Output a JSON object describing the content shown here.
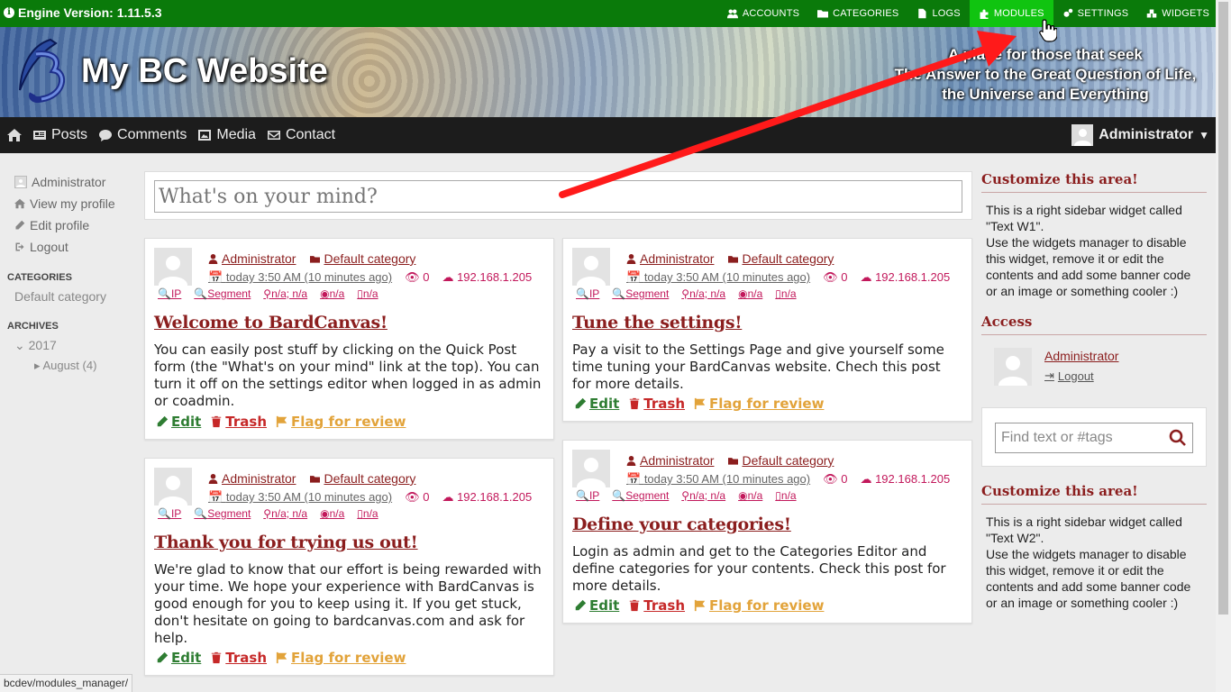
{
  "adminbar": {
    "version": "Engine Version: 1.11.5.3",
    "menu": [
      {
        "label": "Accounts",
        "icon": "users-icon"
      },
      {
        "label": "Categories",
        "icon": "folder-icon"
      },
      {
        "label": "Logs",
        "icon": "file-icon"
      },
      {
        "label": "Modules",
        "icon": "puzzle-icon",
        "active": true
      },
      {
        "label": "Settings",
        "icon": "cogs-icon"
      },
      {
        "label": "Widgets",
        "icon": "cubes-icon"
      }
    ],
    "active_color": "#10c410",
    "bar_color": "#0a7a0a"
  },
  "header": {
    "title": "My BC Website",
    "slogan_lines": [
      "A place for those that seek",
      "The Answer to the Great Question of Life,",
      "the Universe and Everything"
    ]
  },
  "mainnav": {
    "items": [
      {
        "label": "",
        "icon": "home-icon"
      },
      {
        "label": "Posts",
        "icon": "newspaper-icon"
      },
      {
        "label": "Comments",
        "icon": "comments-icon"
      },
      {
        "label": "Media",
        "icon": "image-icon"
      },
      {
        "label": "Contact",
        "icon": "envelope-icon"
      }
    ],
    "user": "Administrator"
  },
  "leftbar": {
    "user": "Administrator",
    "links": [
      "View my profile",
      "Edit profile",
      "Logout"
    ],
    "categories_heading": "Categories",
    "categories": [
      "Default category"
    ],
    "archives_heading": "Archives",
    "year": "2017",
    "month": "August (4)"
  },
  "quickpost": {
    "placeholder": "What's on your mind?"
  },
  "posts": [
    {
      "author": "Administrator",
      "category": "Default category",
      "date": "today 3:50 AM (10 minutes ago)",
      "views": "0",
      "ip": "192.168.1.205",
      "ip_label": "IP",
      "segment": "Segment",
      "location": "n/a; n/a",
      "isp": "n/a",
      "device": "n/a",
      "title": "Welcome to BardCanvas!",
      "text": "You can easily post stuff by clicking on the Quick Post form (the \"What's on your mind\" link at the top). You can turn it off on the settings editor when logged in as admin or coadmin."
    },
    {
      "author": "Administrator",
      "category": "Default category",
      "date": "today 3:50 AM (10 minutes ago)",
      "views": "0",
      "ip": "192.168.1.205",
      "ip_label": "IP",
      "segment": "Segment",
      "location": "n/a; n/a",
      "isp": "n/a",
      "device": "n/a",
      "title": "Tune the settings!",
      "text": "Pay a visit to the Settings Page and give yourself some time tuning your BardCanvas website. Chech this post for more details."
    },
    {
      "author": "Administrator",
      "category": "Default category",
      "date": "today 3:50 AM (10 minutes ago)",
      "views": "0",
      "ip": "192.168.1.205",
      "ip_label": "IP",
      "segment": "Segment",
      "location": "n/a; n/a",
      "isp": "n/a",
      "device": "n/a",
      "title": "Thank you for trying us out!",
      "text": "We're glad to know that our effort is being rewarded with your time. We hope your experience with BardCanvas is good enough for you to keep using it. If you get stuck, don't hesitate on going to bardcanvas.com and ask for help."
    },
    {
      "author": "Administrator",
      "category": "Default category",
      "date": "today 3:50 AM (10 minutes ago)",
      "views": "0",
      "ip": "192.168.1.205",
      "ip_label": "IP",
      "segment": "Segment",
      "location": "n/a; n/a",
      "isp": "n/a",
      "device": "n/a",
      "title": "Define your categories!",
      "text": "Login as admin and get to the Categories Editor and define categories for your contents. Check this post for more details."
    }
  ],
  "actions": {
    "edit": "Edit",
    "trash": "Trash",
    "flag": "Flag for review"
  },
  "rightbar": {
    "w1_title": "Customize this area!",
    "w1_text": "This is a right sidebar widget called \"Text W1\".",
    "w1_text2": "Use the widgets manager to disable this widget, remove it or edit the contents and add some banner code or an image or something cooler :)",
    "access_title": "Access",
    "access_user": "Administrator",
    "access_logout": "Logout",
    "search_placeholder": "Find text or #tags",
    "w2_title": "Customize this area!",
    "w2_text": "This is a right sidebar widget called \"Text W2\".",
    "w2_text2": "Use the widgets manager to disable this widget, remove it or edit the contents and add some banner code or an image or something cooler :)"
  },
  "status_url": "bcdev/modules_manager/",
  "annotation_color": "#ff1a1a"
}
